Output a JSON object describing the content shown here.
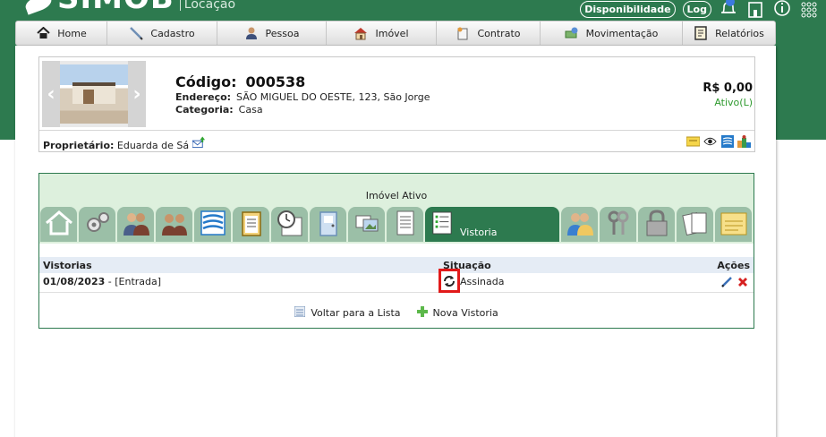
{
  "brand": {
    "name": "SIMOB",
    "subtitle": "Locação"
  },
  "top_actions": {
    "availability_label": "Disponibilidade",
    "log_label": "Log",
    "icons": [
      "bell-icon",
      "building-icon",
      "info-icon",
      "grid-icon"
    ]
  },
  "nav": {
    "items": [
      {
        "label": "Home",
        "icon": "home-icon"
      },
      {
        "label": "Cadastro",
        "icon": "pen-icon"
      },
      {
        "label": "Pessoa",
        "icon": "person-icon"
      },
      {
        "label": "Imóvel",
        "icon": "house-icon"
      },
      {
        "label": "Contrato",
        "icon": "contract-icon"
      },
      {
        "label": "Movimentação",
        "icon": "money-icon"
      },
      {
        "label": "Relatórios",
        "icon": "report-icon"
      }
    ]
  },
  "property": {
    "code_label": "Código:",
    "code": "000538",
    "address_label": "Endereço:",
    "address": "SÃO MIGUEL DO OESTE, 123, São Jorge",
    "category_label": "Categoria:",
    "category": "Casa",
    "price": "R$ 0,00",
    "status": "Ativo(L)",
    "owner_label": "Proprietário:",
    "owner": "Eduarda de Sá"
  },
  "panel": {
    "title": "Imóvel Ativo",
    "active_tab": "Vistoria",
    "list": {
      "headers": {
        "col1": "Vistorias",
        "col2": "Situação",
        "col3": "Ações"
      },
      "rows": [
        {
          "date": "01/08/2023",
          "type": "- [Entrada]",
          "situation": "Assinada"
        }
      ]
    },
    "footer": {
      "back_label": "Voltar para a Lista",
      "new_label": "Nova Vistoria"
    }
  },
  "colors": {
    "brand_green": "#2d7a4f",
    "tab_green": "#9bbfa7",
    "panel_bg": "#ddf0dd",
    "highlight_red": "#e11a1a",
    "status_green": "#2f9a2f"
  }
}
